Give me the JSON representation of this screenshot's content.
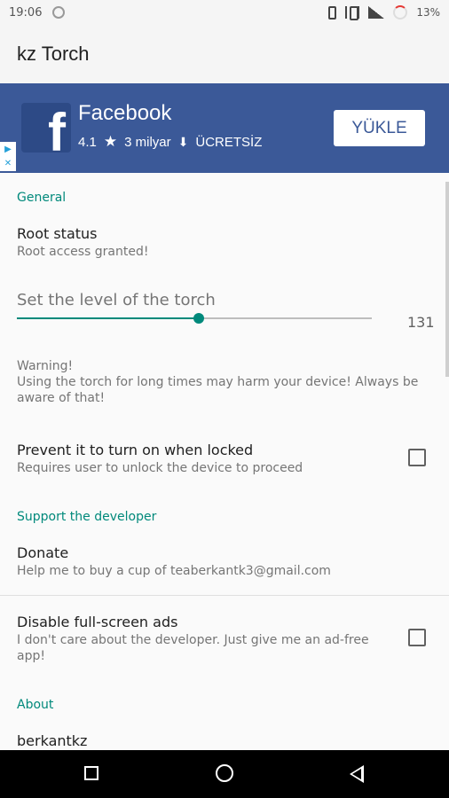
{
  "status_bar": {
    "time": "19:06",
    "battery": "13%",
    "icons": [
      "sync-icon",
      "phone-icon",
      "vibrate-icon",
      "signal-icon",
      "battery-icon"
    ]
  },
  "app_bar": {
    "title": "kz Torch"
  },
  "ad": {
    "app_name": "Facebook",
    "rating": "4.1",
    "downloads": "3 milyar",
    "price": "ÜCRETSİZ",
    "install_label": "YÜKLE",
    "logo_letter": "f",
    "colors": {
      "background": "#3b5998",
      "button_text": "#3b5998"
    }
  },
  "settings": {
    "general": {
      "header": "General",
      "root_status": {
        "title": "Root status",
        "summary": "Root access granted!"
      },
      "torch_level": {
        "title": "Set the level of the torch",
        "value": "131",
        "max": 255
      },
      "warning": "Warning!\nUsing the torch for long times may harm your device! Always be aware of that!",
      "prevent_locked": {
        "title": "Prevent it to turn on when locked",
        "summary": "Requires user to unlock the device to proceed",
        "checked": false
      }
    },
    "support": {
      "header": "Support the developer",
      "donate": {
        "title": "Donate",
        "summary": "Help me to buy a cup of teaberkantk3@gmail.com"
      },
      "disable_ads": {
        "title": "Disable full-screen ads",
        "summary": "I don't care about the developer. Just give me an ad-free app!",
        "checked": false
      }
    },
    "about": {
      "header": "About",
      "author": {
        "title": "berkantkz"
      }
    }
  },
  "accent_color": "#00897b"
}
